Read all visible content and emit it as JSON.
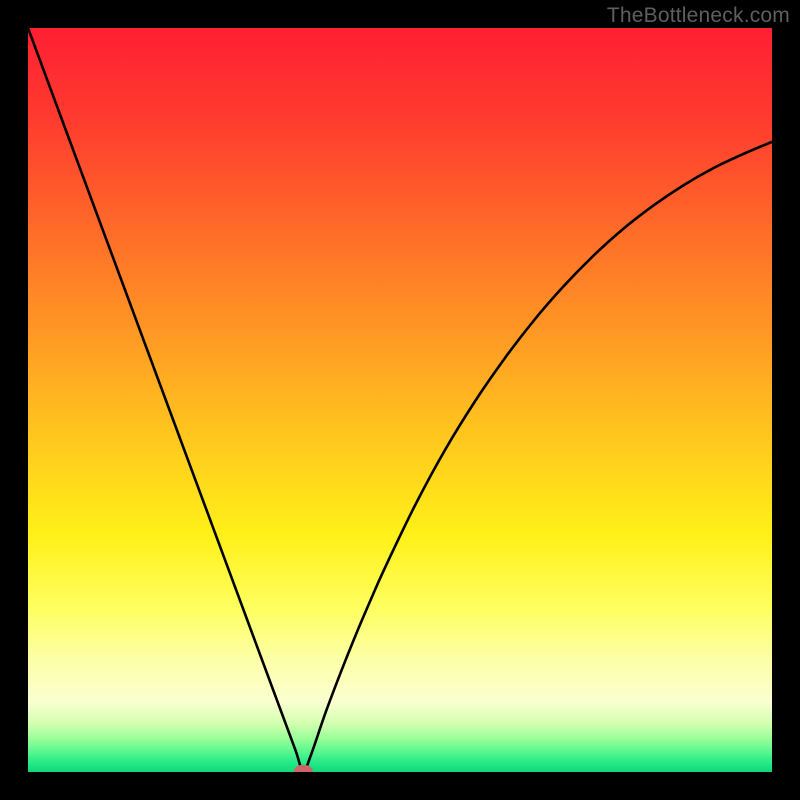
{
  "watermark": "TheBottleneck.com",
  "chart_data": {
    "type": "line",
    "title": "",
    "xlabel": "",
    "ylabel": "",
    "xlim": [
      0,
      100
    ],
    "ylim": [
      0,
      100
    ],
    "x": [
      0,
      4,
      8,
      12,
      16,
      20,
      24,
      28,
      30,
      32,
      33.5,
      35,
      36,
      37,
      38,
      40,
      42,
      44,
      46,
      48,
      52,
      56,
      60,
      64,
      68,
      72,
      76,
      80,
      84,
      88,
      92,
      96,
      100
    ],
    "y": [
      100,
      89.2,
      78.4,
      67.6,
      56.8,
      46,
      35.2,
      24.4,
      19.0,
      13.6,
      9.55,
      5.5,
      2.8,
      0.1,
      2.2,
      8.0,
      13.3,
      18.3,
      23.0,
      27.5,
      35.8,
      43.2,
      49.7,
      55.5,
      60.7,
      65.3,
      69.4,
      73.0,
      76.1,
      78.8,
      81.1,
      83.0,
      84.7
    ],
    "marker": {
      "x": 37,
      "y": 0.1
    },
    "gradient_stops": [
      {
        "offset": 0.0,
        "color": "#ff1f33"
      },
      {
        "offset": 0.12,
        "color": "#ff3a2f"
      },
      {
        "offset": 0.25,
        "color": "#ff642a"
      },
      {
        "offset": 0.4,
        "color": "#ff9524"
      },
      {
        "offset": 0.55,
        "color": "#ffc71e"
      },
      {
        "offset": 0.68,
        "color": "#fff018"
      },
      {
        "offset": 0.78,
        "color": "#feff60"
      },
      {
        "offset": 0.85,
        "color": "#fcffa8"
      },
      {
        "offset": 0.905,
        "color": "#faffd0"
      },
      {
        "offset": 0.935,
        "color": "#d2ffb0"
      },
      {
        "offset": 0.955,
        "color": "#99ff99"
      },
      {
        "offset": 0.975,
        "color": "#50f58e"
      },
      {
        "offset": 0.99,
        "color": "#1de784"
      },
      {
        "offset": 1.0,
        "color": "#14d67c"
      }
    ],
    "colors": {
      "curve": "#000000",
      "marker_fill": "#cc6666",
      "marker_stroke": "#cc6666",
      "background_outer": "#000000"
    }
  }
}
